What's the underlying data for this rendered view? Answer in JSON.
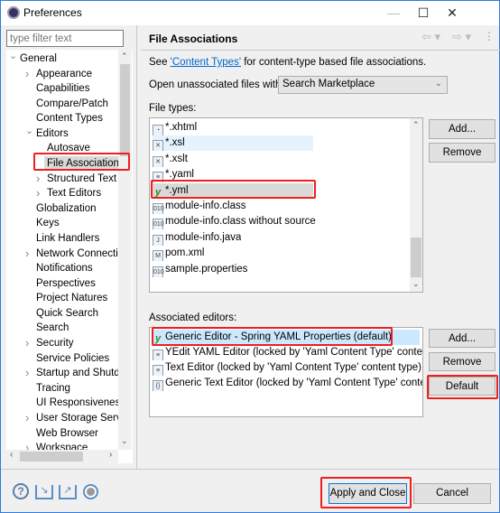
{
  "window": {
    "title": "Preferences",
    "minimize": "—",
    "maximize": "☐",
    "close": "✕"
  },
  "filter": {
    "placeholder": "type filter text"
  },
  "tree": [
    {
      "label": "General",
      "level": 0,
      "expander": "open"
    },
    {
      "label": "Appearance",
      "level": 1,
      "expander": "closed"
    },
    {
      "label": "Capabilities",
      "level": 1
    },
    {
      "label": "Compare/Patch",
      "level": 1
    },
    {
      "label": "Content Types",
      "level": 1
    },
    {
      "label": "Editors",
      "level": 1,
      "expander": "open"
    },
    {
      "label": "Autosave",
      "level": 2
    },
    {
      "label": "File Associations",
      "level": 2,
      "selected": true
    },
    {
      "label": "Structured Text E",
      "level": 2,
      "expander": "closed"
    },
    {
      "label": "Text Editors",
      "level": 2,
      "expander": "closed"
    },
    {
      "label": "Globalization",
      "level": 1
    },
    {
      "label": "Keys",
      "level": 1
    },
    {
      "label": "Link Handlers",
      "level": 1
    },
    {
      "label": "Network Connectio",
      "level": 1,
      "expander": "closed"
    },
    {
      "label": "Notifications",
      "level": 1
    },
    {
      "label": "Perspectives",
      "level": 1
    },
    {
      "label": "Project Natures",
      "level": 1
    },
    {
      "label": "Quick Search",
      "level": 1
    },
    {
      "label": "Search",
      "level": 1
    },
    {
      "label": "Security",
      "level": 1,
      "expander": "closed"
    },
    {
      "label": "Service Policies",
      "level": 1
    },
    {
      "label": "Startup and Shutdo",
      "level": 1,
      "expander": "closed"
    },
    {
      "label": "Tracing",
      "level": 1
    },
    {
      "label": "UI Responsiveness",
      "level": 1
    },
    {
      "label": "User Storage Servic",
      "level": 1,
      "expander": "closed"
    },
    {
      "label": "Web Browser",
      "level": 1
    },
    {
      "label": "Workspace",
      "level": 1,
      "expander": "closed"
    }
  ],
  "page": {
    "title": "File Associations",
    "see_prefix": "See ",
    "link": "'Content Types'",
    "see_suffix": " for content-type based file associations.",
    "open_label": "Open unassociated files with:",
    "open_value": "Search Marketplace",
    "file_types_label": "File types:",
    "file_types": [
      {
        "label": "*.xhtml",
        "icon": "html-file-icon"
      },
      {
        "label": "*.xsl",
        "icon": "xsl-file-icon",
        "hover": true
      },
      {
        "label": "*.xslt",
        "icon": "xsl-file-icon"
      },
      {
        "label": "*.yaml",
        "icon": "text-file-icon"
      },
      {
        "label": "*.yml",
        "icon": "yaml-file-icon",
        "selected": true
      },
      {
        "label": "module-info.class",
        "icon": "class-file-icon"
      },
      {
        "label": "module-info.class without source",
        "icon": "class-file-icon"
      },
      {
        "label": "module-info.java",
        "icon": "java-file-icon"
      },
      {
        "label": "pom.xml",
        "icon": "maven-file-icon"
      },
      {
        "label": "sample.properties",
        "icon": "properties-file-icon"
      }
    ],
    "file_add": "Add...",
    "file_remove": "Remove",
    "editors_label": "Associated editors:",
    "editors": [
      {
        "label": "Generic Editor - Spring YAML Properties (default)",
        "icon": "yaml-editor-icon",
        "selected": true
      },
      {
        "label": "YEdit YAML Editor (locked by 'Yaml Content Type' content type)",
        "icon": "text-file-icon"
      },
      {
        "label": "Text Editor (locked by 'Yaml Content Type' content type)",
        "icon": "text-file-icon"
      },
      {
        "label": "Generic Text Editor (locked by 'Yaml Content Type' content type)",
        "icon": "generic-editor-icon"
      }
    ],
    "ed_add": "Add...",
    "ed_remove": "Remove",
    "ed_default": "Default"
  },
  "footer": {
    "apply_close": "Apply and Close",
    "cancel": "Cancel"
  },
  "colors": {
    "highlight": "#f01e1e",
    "link": "#0066cc",
    "selection": "#cce8ff"
  }
}
